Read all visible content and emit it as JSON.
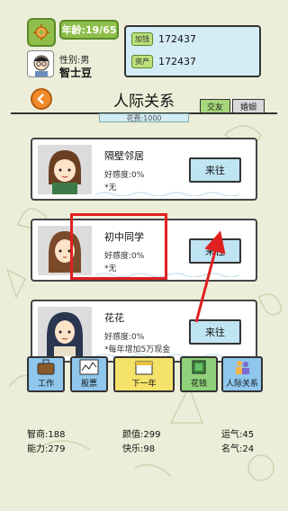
{
  "header": {
    "age": "年龄:19/65",
    "gender": "性别:男",
    "name": "智士豆",
    "cash_label": "加钱",
    "cash_value": "172437",
    "assets_label": "资产",
    "assets_value": "172437"
  },
  "page": {
    "title": "人际关系",
    "tabs": [
      "交友",
      "婚姻"
    ],
    "charm": "花费:1000"
  },
  "contacts": [
    {
      "name": "隔壁邻居",
      "favor": "好感度:0%",
      "note": "*无",
      "button": "来往"
    },
    {
      "name": "初中同学",
      "favor": "好感度:0%",
      "note": "*无",
      "button": "来往"
    },
    {
      "name": "花花",
      "favor": "好感度:0%",
      "note": "*每年增加5万现金",
      "button": "来往"
    }
  ],
  "nav": [
    {
      "label": "工作",
      "icon": "briefcase-icon"
    },
    {
      "label": "股票",
      "icon": "stock-chart-icon"
    },
    {
      "label": "下一年",
      "icon": "calendar-icon"
    },
    {
      "label": "花钱",
      "icon": "money-icon"
    },
    {
      "label": "人际关系",
      "icon": "people-icon"
    }
  ],
  "stats": {
    "intellect": "智商:188",
    "looks": "颜值:299",
    "luck": "运气:45",
    "ability": "能力:279",
    "happiness": "快乐:98",
    "fame": "名气:24"
  },
  "colors": {
    "background": "#eceed9",
    "accent_green": "#8fbf4a",
    "button_blue": "#bfe4f2",
    "highlight_red": "#e02020"
  }
}
